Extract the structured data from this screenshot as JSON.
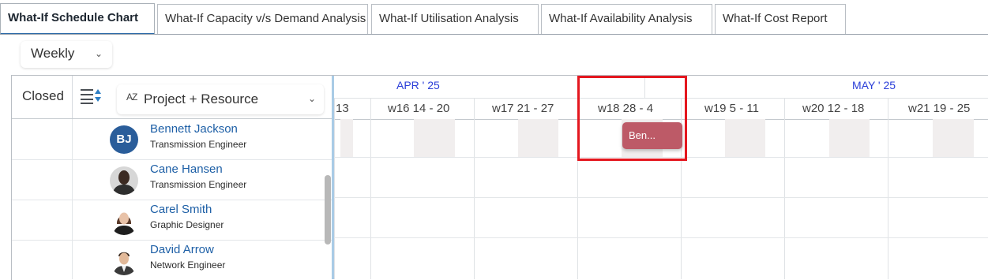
{
  "tabs": [
    {
      "label": "What-If Schedule Chart",
      "active": true
    },
    {
      "label": "What-If Capacity v/s Demand Analysis",
      "active": false
    },
    {
      "label": "What-If Utilisation Analysis",
      "active": false
    },
    {
      "label": "What-If Availability Analysis",
      "active": false
    },
    {
      "label": "What-If Cost Report",
      "active": false
    }
  ],
  "period": {
    "value": "Weekly"
  },
  "left_header": {
    "closed_label": "Closed",
    "sort_icon": "sort-lines-icon",
    "az_glyph": "AZ",
    "group_by": "Project + Resource"
  },
  "resources": [
    {
      "name": "Bennett Jackson",
      "role": "Transmission Engineer",
      "initials": "BJ"
    },
    {
      "name": "Cane Hansen",
      "role": "Transmission Engineer"
    },
    {
      "name": "Carel Smith",
      "role": "Graphic Designer"
    },
    {
      "name": "David Arrow",
      "role": "Network Engineer"
    }
  ],
  "timeline": {
    "months": [
      "APR ' 25",
      "MAY ' 25"
    ],
    "weeks": [
      "13",
      "w16 14 - 20",
      "w17 21 - 27",
      "w18 28 - 4",
      "w19 5 - 11",
      "w20 12 - 18",
      "w21 19 - 25"
    ],
    "bar": {
      "label": "Ben...",
      "color": "#bd5a67"
    }
  },
  "colors": {
    "month_text": "#2a3ed8",
    "name_link": "#1d5fa6",
    "highlight": "#e4171f",
    "avatar_bg": "#2a5d9a"
  }
}
